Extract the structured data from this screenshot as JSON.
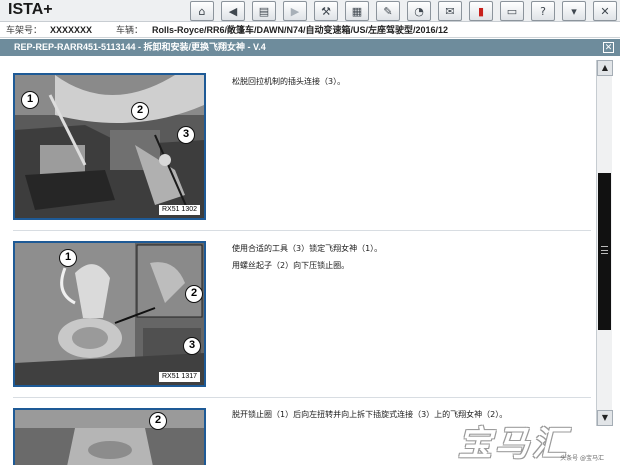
{
  "app": {
    "title": "ISTA+"
  },
  "toolbar": {
    "buttons": [
      {
        "name": "home-button",
        "icon": "home-icon",
        "glyph": "⌂"
      },
      {
        "name": "back-button",
        "icon": "arrow-left-icon",
        "glyph": "◀"
      },
      {
        "name": "document-button",
        "icon": "document-icon",
        "glyph": "▤"
      },
      {
        "name": "forward-button",
        "icon": "arrow-right-icon",
        "glyph": "▶"
      },
      {
        "name": "service-button",
        "icon": "wrench-icon",
        "glyph": "⚒"
      },
      {
        "name": "vehicle-data-button",
        "icon": "grid-icon",
        "glyph": "▦"
      },
      {
        "name": "edit-button",
        "icon": "pencil-icon",
        "glyph": "✎"
      },
      {
        "name": "measure-button",
        "icon": "gauge-icon",
        "glyph": "◔"
      },
      {
        "name": "message-button",
        "icon": "envelope-icon",
        "glyph": "✉"
      },
      {
        "name": "battery-button",
        "icon": "battery-icon",
        "glyph": "▮"
      },
      {
        "name": "screen-button",
        "icon": "monitor-icon",
        "glyph": "▭"
      },
      {
        "name": "help-button",
        "icon": "question-icon",
        "glyph": "?"
      },
      {
        "name": "minimize-button",
        "icon": "minimize-icon",
        "glyph": "▾"
      },
      {
        "name": "close-app-button",
        "icon": "close-icon",
        "glyph": "✕"
      }
    ]
  },
  "vehicle_info": {
    "vin_label": "车架号：",
    "vin_value": "XXXXXXX",
    "vehicle_label": "车辆：",
    "vehicle_value": "Rolls-Royce/RR6/敞篷车/DAWN/N74/自动变速箱/US/左座驾驶型/2016/12"
  },
  "document": {
    "title": "REP-REP-RARR451-5113144 - 拆卸和安装/更换飞翔女神 - V.4"
  },
  "steps": [
    {
      "text_lines": [
        "松脱回拉机制的插头连接（3）。"
      ],
      "figure_label": "RX51 1302",
      "callouts": [
        "1",
        "2",
        "3"
      ]
    },
    {
      "text_lines": [
        "使用合适的工具（3）锁定飞翔女神（1）。",
        "用螺丝起子（2）向下压锁止圈。"
      ],
      "figure_label": "RX51 1317",
      "callouts": [
        "1",
        "2",
        "3"
      ]
    },
    {
      "text_lines": [
        "脱开锁止圈（1）后向左扭转并向上拆下插旋式连接（3）上的飞翔女神（2）。"
      ],
      "callouts": [
        "2"
      ]
    }
  ],
  "scrollbar": {
    "up_glyph": "▲",
    "down_glyph": "▼"
  },
  "watermark": {
    "main": "宝马汇",
    "sub": "头条号 @宝马汇"
  },
  "colors": {
    "header_bar": "#6e8c9c",
    "figure_border": "#1e5a96",
    "alert": "#c8201c"
  }
}
